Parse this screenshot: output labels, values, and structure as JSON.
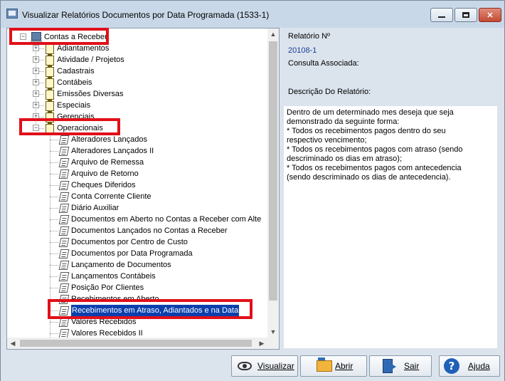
{
  "window": {
    "title": "Visualizar Relatórios Documentos por Data Programada (1533-1)",
    "controls": {
      "minimize": "–",
      "maximize": "□",
      "close": "✕"
    }
  },
  "tree": {
    "root": "Contas a Receber",
    "groups": [
      {
        "label": "Adiantamentos",
        "expanded": false
      },
      {
        "label": "Atividade / Projetos",
        "expanded": false
      },
      {
        "label": "Cadastrais",
        "expanded": false
      },
      {
        "label": "Contábeis",
        "expanded": false
      },
      {
        "label": "Emissões Diversas",
        "expanded": false
      },
      {
        "label": "Especiais",
        "expanded": false
      },
      {
        "label": "Gerenciais",
        "expanded": false
      },
      {
        "label": "Operacionais",
        "expanded": true
      }
    ],
    "reports": [
      "Alteradores  Lançados",
      "Alteradores  Lançados II",
      "Arquivo de Remessa",
      "Arquivo de Retorno",
      "Cheques Diferidos",
      "Conta Corrente Cliente",
      "Diário  Auxiliar",
      "Documentos em Aberto no Contas a Receber com Alte",
      "Documentos Lançados no Contas a Receber",
      "Documentos por Centro de Custo",
      "Documentos por Data Programada",
      "Lançamento  de Documentos",
      "Lançamentos Contábeis",
      "Posição Por Clientes",
      "Recebimentos em Aberto",
      "Recebimentos em Atraso, Adiantados e na Data",
      "Valores Recebidos",
      "Valores Recebidos II"
    ],
    "selected_report": "Recebimentos em Atraso, Adiantados e na Data"
  },
  "details": {
    "report_number_label": "Relatório Nº",
    "report_number": "20108-1",
    "associated_query_label": "Consulta Associada:",
    "description_label": "Descrição Do Relatório:",
    "description": "Dentro de um determinado mes deseja que seja\ndemonstrado da seguinte forma:\n* Todos os recebimentos pagos dentro do seu\nrespectivo vencimento;\n* Todos os recebimentos pagos com atraso (sendo\ndescriminado os dias em atraso);\n* Todos os recebimentos pagos com antecedencia\n(sendo descriminado os dias de antecedencia)."
  },
  "buttons": {
    "visualizar": "Visualizar",
    "abrir": "Abrir",
    "sair": "Sair",
    "ajuda": "Ajuda"
  },
  "colors": {
    "highlight": "#e0101a",
    "selection": "#0b3fae",
    "value_text": "#1b3f9a"
  }
}
